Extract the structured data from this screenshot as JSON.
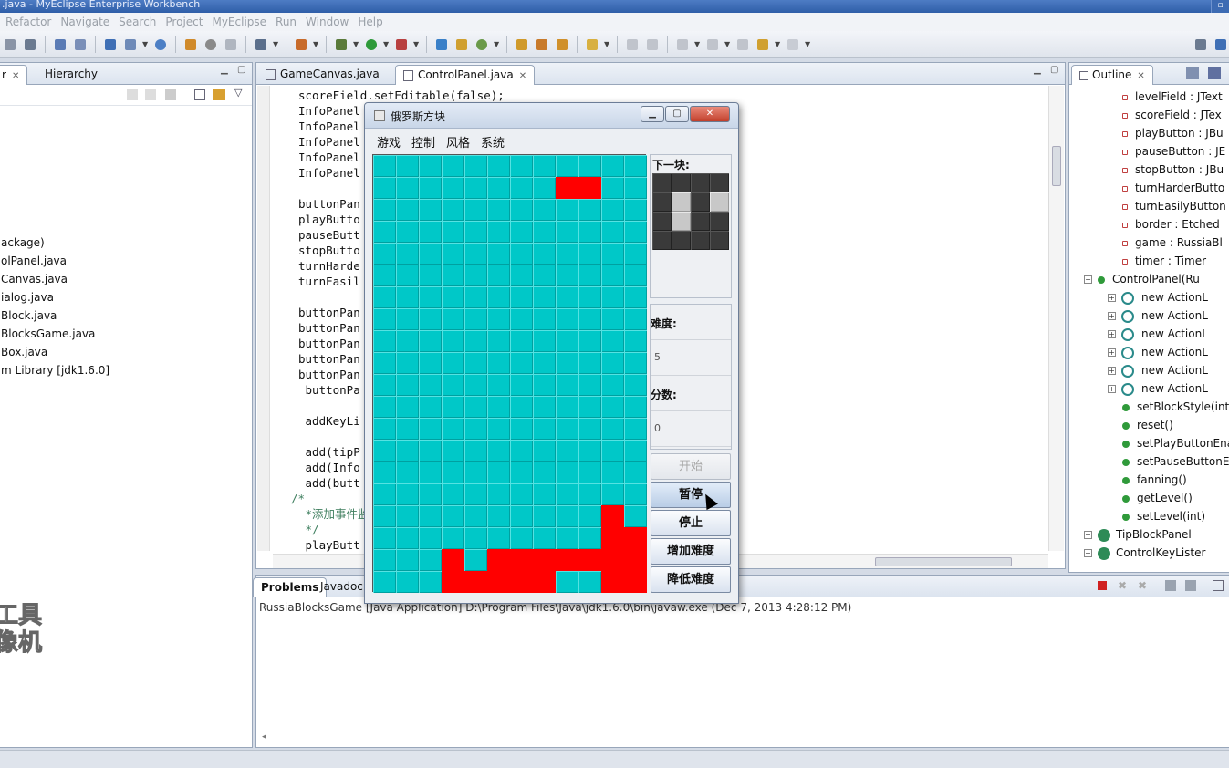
{
  "window": {
    "title": ".java - MyEclipse Enterprise Workbench"
  },
  "menubar": [
    "Refactor",
    "Navigate",
    "Search",
    "Project",
    "MyEclipse",
    "Run",
    "Window",
    "Help"
  ],
  "left_panel": {
    "tabs": [
      {
        "label": "r"
      },
      {
        "label": "Hierarchy"
      }
    ],
    "tree_items": [
      "ackage)",
      "olPanel.java",
      "Canvas.java",
      "ialog.java",
      "Block.java",
      "BlocksGame.java",
      "Box.java",
      "m Library [jdk1.6.0]"
    ]
  },
  "editor": {
    "tabs": [
      {
        "label": "GameCanvas.java"
      },
      {
        "label": "ControlPanel.java"
      }
    ],
    "code_lines": [
      {
        "text": "scoreField.setEditable(false);",
        "indent": 0,
        "comment": false
      },
      {
        "text": "InfoPanel",
        "indent": 0,
        "comment": false
      },
      {
        "text": "InfoPanel",
        "indent": 0,
        "comment": false
      },
      {
        "text": "InfoPanel",
        "indent": 0,
        "comment": false
      },
      {
        "text": "InfoPanel",
        "indent": 0,
        "comment": false
      },
      {
        "text": "InfoPanel",
        "indent": 0,
        "comment": false
      },
      {
        "text": "",
        "indent": 0,
        "comment": false
      },
      {
        "text": "buttonPan",
        "indent": 0,
        "comment": false
      },
      {
        "text": "playButto",
        "indent": 0,
        "comment": false
      },
      {
        "text": "pauseButt",
        "indent": 0,
        "comment": false
      },
      {
        "text": "stopButto",
        "indent": 0,
        "comment": false
      },
      {
        "text": "turnHarde",
        "indent": 0,
        "comment": false
      },
      {
        "text": "turnEasil",
        "indent": 0,
        "comment": false
      },
      {
        "text": "",
        "indent": 0,
        "comment": false
      },
      {
        "text": "buttonPan",
        "indent": 0,
        "comment": false
      },
      {
        "text": "buttonPan",
        "indent": 0,
        "comment": false
      },
      {
        "text": "buttonPan",
        "indent": 0,
        "comment": false
      },
      {
        "text": "buttonPan",
        "indent": 0,
        "comment": false
      },
      {
        "text": "buttonPan",
        "indent": 0,
        "comment": false
      },
      {
        "text": " buttonPa",
        "indent": 0,
        "comment": false
      },
      {
        "text": "",
        "indent": 0,
        "comment": false
      },
      {
        "text": " addKeyLi",
        "indent": 0,
        "comment": false
      },
      {
        "text": "",
        "indent": 0,
        "comment": false
      },
      {
        "text": " add(tipP",
        "indent": 0,
        "comment": false
      },
      {
        "text": " add(Info",
        "indent": 0,
        "comment": false
      },
      {
        "text": " add(butt",
        "indent": 0,
        "comment": false
      },
      {
        "text": "/*",
        "indent": -1,
        "comment": true
      },
      {
        "text": " *添加事件监",
        "indent": 0,
        "comment": true
      },
      {
        "text": " */",
        "indent": 0,
        "comment": true
      },
      {
        "text": " playButt",
        "indent": 0,
        "comment": false
      }
    ]
  },
  "outline": {
    "tab_label": "Outline",
    "rows": [
      {
        "label": "levelField : JText",
        "kind": "field",
        "level": 1,
        "expand": false
      },
      {
        "label": "scoreField : JTex",
        "kind": "field",
        "level": 1,
        "expand": false
      },
      {
        "label": "playButton : JBu",
        "kind": "field",
        "level": 1,
        "expand": false
      },
      {
        "label": "pauseButton : JE",
        "kind": "field",
        "level": 1,
        "expand": false
      },
      {
        "label": "stopButton : JBu",
        "kind": "field",
        "level": 1,
        "expand": false
      },
      {
        "label": "turnHarderButto",
        "kind": "field",
        "level": 1,
        "expand": false
      },
      {
        "label": "turnEasilyButton",
        "kind": "field",
        "level": 1,
        "expand": false
      },
      {
        "label": "border : Etched",
        "kind": "field",
        "level": 1,
        "expand": false
      },
      {
        "label": "game : RussiaBl",
        "kind": "field",
        "level": 1,
        "expand": false
      },
      {
        "label": "timer : Timer",
        "kind": "field",
        "level": 1,
        "expand": false
      },
      {
        "label": "ControlPanel(Ru",
        "kind": "method",
        "level": 0,
        "expand": true
      },
      {
        "label": "new ActionL",
        "kind": "anon",
        "level": 2,
        "expand": true
      },
      {
        "label": "new ActionL",
        "kind": "anon",
        "level": 2,
        "expand": true
      },
      {
        "label": "new ActionL",
        "kind": "anon",
        "level": 2,
        "expand": true
      },
      {
        "label": "new ActionL",
        "kind": "anon",
        "level": 2,
        "expand": true
      },
      {
        "label": "new ActionL",
        "kind": "anon",
        "level": 2,
        "expand": true
      },
      {
        "label": "new ActionL",
        "kind": "anon",
        "level": 2,
        "expand": true
      },
      {
        "label": "setBlockStyle(int",
        "kind": "method",
        "level": 1,
        "expand": false
      },
      {
        "label": "reset()",
        "kind": "method",
        "level": 1,
        "expand": false
      },
      {
        "label": "setPlayButtonEna",
        "kind": "method",
        "level": 1,
        "expand": false
      },
      {
        "label": "setPauseButtonE",
        "kind": "method",
        "level": 1,
        "expand": false
      },
      {
        "label": "fanning()",
        "kind": "method",
        "level": 1,
        "expand": false
      },
      {
        "label": "getLevel()",
        "kind": "method",
        "level": 1,
        "expand": false
      },
      {
        "label": "setLevel(int)",
        "kind": "method",
        "level": 1,
        "expand": false
      },
      {
        "label": "TipBlockPanel",
        "kind": "cls",
        "level": 0,
        "expand": true
      },
      {
        "label": "ControlKeyLister",
        "kind": "cls",
        "level": 0,
        "expand": true
      }
    ]
  },
  "console": {
    "tabs": [
      {
        "label": "Problems"
      },
      {
        "label": "Javadoc"
      }
    ],
    "text": "RussiaBlocksGame [Java Application] D:\\Program Files\\Java\\jdk1.6.0\\bin\\javaw.exe (Dec 7, 2013 4:28:12 PM)"
  },
  "watermark": [
    "工具",
    "像机"
  ],
  "game": {
    "title": "俄罗斯方块",
    "menus": [
      "游戏",
      "控制",
      "风格",
      "系统"
    ],
    "next_label": "下一块:",
    "level_label": "难度:",
    "level_value": "5",
    "score_label": "分数:",
    "score_value": "0",
    "buttons": {
      "start": "开始",
      "pause": "暂停",
      "stop": "停止",
      "harder": "增加难度",
      "easier": "降低难度"
    },
    "colors": {
      "block": "#ff0000",
      "empty": "#00c8c8"
    },
    "board": [
      "..........",
      ".......#..",
      "......##..",
      "..........",
      "..........",
      "..........",
      "..........",
      "..........",
      "..........",
      "..........",
      "..........",
      "..........",
      "..........",
      "..........",
      "..........",
      "..........",
      "..........",
      "..........",
      "..........",
      "..........",
      "..........",
      "..........",
      "..........",
      "..........",
      "..........",
      "..........",
      "..........",
      "..........",
      "..........",
      "..........",
      "..........",
      "..........",
      "..........",
      "..........",
      "..........",
      "..........",
      "..........",
      "..........",
      "........#.",
      "........##",
      "........##",
      "........##",
      ".......###",
      "..#.######",
      "..########",
      "..####..##",
      "..........",
      ".........."
    ],
    "preview": [
      "....",
      ".#.#",
      ".#..",
      "...."
    ]
  }
}
